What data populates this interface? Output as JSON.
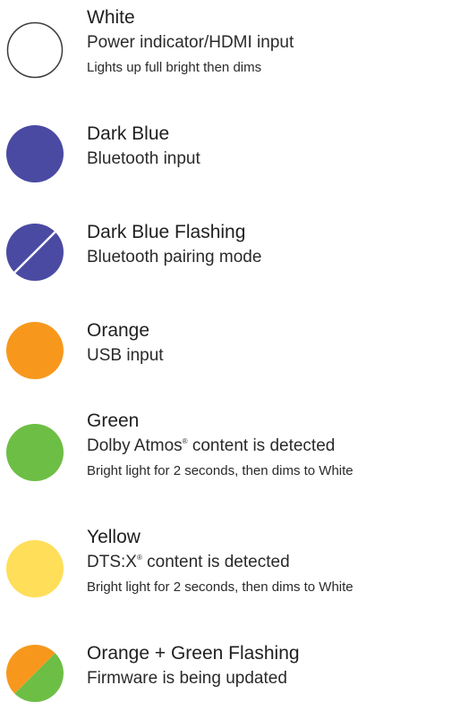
{
  "entries": [
    {
      "name": "White",
      "description": "Power indicator/HDMI input",
      "note": "Lights up full bright then dims",
      "swatch": {
        "style": "outline",
        "fill": "#ffffff",
        "stroke": "#3a3a3a"
      }
    },
    {
      "name": "Dark Blue",
      "description": "Bluetooth input",
      "swatch": {
        "style": "solid",
        "fill": "#4a4aa3"
      }
    },
    {
      "name": "Dark Blue Flashing",
      "description": "Bluetooth pairing mode",
      "swatch": {
        "style": "slash",
        "fill": "#4a4aa3",
        "line": "#ffffff"
      }
    },
    {
      "name": "Orange",
      "description": "USB input",
      "swatch": {
        "style": "solid",
        "fill": "#f7981d"
      }
    },
    {
      "name": "Green",
      "description_text": "Dolby Atmos",
      "description_mark": "®",
      "description_suffix": " content is detected",
      "note": "Bright light for 2 seconds, then dims to White",
      "swatch": {
        "style": "solid",
        "fill": "#6dbe45"
      }
    },
    {
      "name": "Yellow",
      "description_text": "DTS:X",
      "description_mark": "®",
      "description_suffix": " content is detected",
      "note": "Bright light for 2 seconds, then dims to White",
      "swatch": {
        "style": "solid",
        "fill": "#ffde59"
      }
    },
    {
      "name": "Orange + Green Flashing",
      "description": "Firmware is being updated",
      "swatch": {
        "style": "split",
        "fill": "#f7981d",
        "fill2": "#6dbe45"
      }
    }
  ]
}
